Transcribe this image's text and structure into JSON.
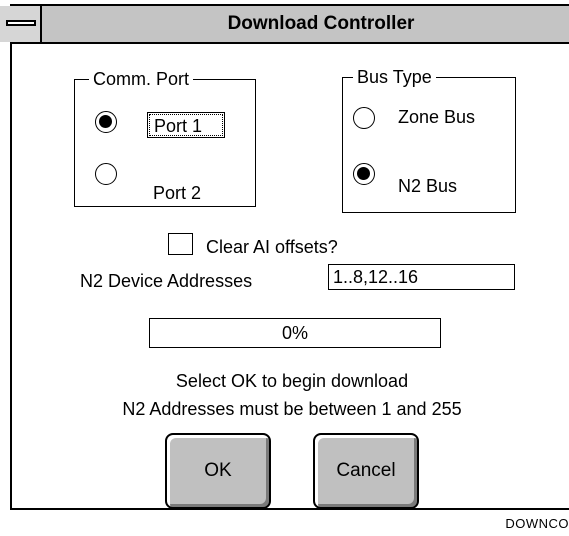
{
  "dialog": {
    "title": "Download Controller"
  },
  "comm_port": {
    "legend": "Comm. Port",
    "options": [
      {
        "label": "Port 1",
        "selected": true
      },
      {
        "label": "Port 2",
        "selected": false
      }
    ]
  },
  "bus_type": {
    "legend": "Bus Type",
    "options": [
      {
        "label": "Zone Bus",
        "selected": false
      },
      {
        "label": "N2 Bus",
        "selected": true
      }
    ]
  },
  "clear_ai": {
    "label": "Clear AI offsets?",
    "checked": false
  },
  "n2_addresses": {
    "label": "N2 Device Addresses",
    "value": "1..8,12..16"
  },
  "progress": {
    "value": 0,
    "text": "0%"
  },
  "messages": {
    "line1": "Select OK to begin download",
    "line2": "N2 Addresses must be between 1 and 255"
  },
  "buttons": {
    "ok": "OK",
    "cancel": "Cancel"
  },
  "caption": "DOWNCO"
}
